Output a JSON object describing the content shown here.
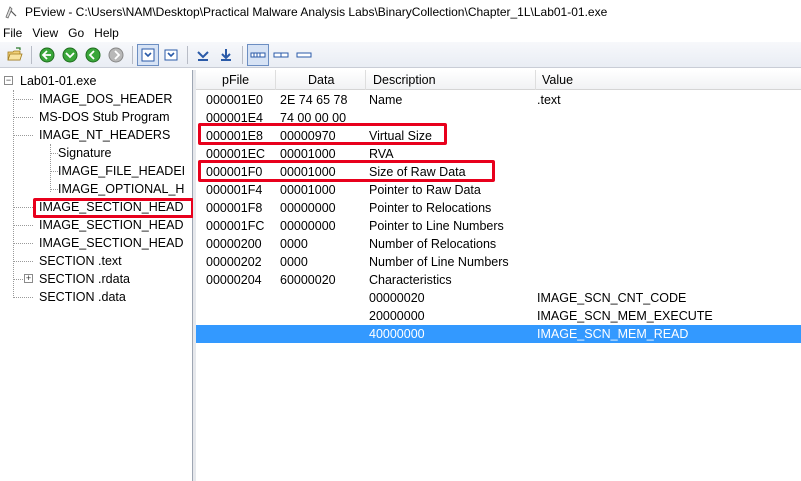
{
  "window": {
    "title": "PEview - C:\\Users\\NAM\\Desktop\\Practical Malware Analysis Labs\\BinaryCollection\\Chapter_1L\\Lab01-01.exe"
  },
  "menu": [
    "File",
    "View",
    "Go",
    "Help"
  ],
  "toolbar": {
    "icons": [
      "open-file-icon",
      "back-icon",
      "forward-icon",
      "up-icon",
      "stop-icon",
      "view-hex-icon",
      "view-value-icon",
      "nav-prev-icon",
      "nav-next-icon",
      "view-bytes-icon",
      "view-words-icon",
      "view-dwords-icon"
    ]
  },
  "tree": {
    "root": "Lab01-01.exe",
    "items": [
      "IMAGE_DOS_HEADER",
      "MS-DOS Stub Program",
      "IMAGE_NT_HEADERS",
      "Signature",
      "IMAGE_FILE_HEADEI",
      "IMAGE_OPTIONAL_H",
      "IMAGE_SECTION_HEAD",
      "IMAGE_SECTION_HEAD",
      "IMAGE_SECTION_HEAD",
      "SECTION .text",
      "SECTION .rdata",
      "SECTION .data"
    ]
  },
  "columns": [
    "pFile",
    "Data",
    "Description",
    "Value"
  ],
  "rows": [
    {
      "pfile": "000001E0",
      "data": "2E 74 65 78",
      "description": "Name",
      "value": ".text"
    },
    {
      "pfile": "000001E4",
      "data": "74 00 00 00",
      "description": "",
      "value": ""
    },
    {
      "pfile": "000001E8",
      "data": "00000970",
      "description": "Virtual Size",
      "value": ""
    },
    {
      "pfile": "000001EC",
      "data": "00001000",
      "description": "RVA",
      "value": ""
    },
    {
      "pfile": "000001F0",
      "data": "00001000",
      "description": "Size of Raw Data",
      "value": ""
    },
    {
      "pfile": "000001F4",
      "data": "00001000",
      "description": "Pointer to Raw Data",
      "value": ""
    },
    {
      "pfile": "000001F8",
      "data": "00000000",
      "description": "Pointer to Relocations",
      "value": ""
    },
    {
      "pfile": "000001FC",
      "data": "00000000",
      "description": "Pointer to Line Numbers",
      "value": ""
    },
    {
      "pfile": "00000200",
      "data": "0000",
      "description": "Number of Relocations",
      "value": ""
    },
    {
      "pfile": "00000202",
      "data": "0000",
      "description": "Number of Line Numbers",
      "value": ""
    },
    {
      "pfile": "00000204",
      "data": "60000020",
      "description": "Characteristics",
      "value": ""
    },
    {
      "pfile": "",
      "data": "",
      "description": "00000020",
      "value": "IMAGE_SCN_CNT_CODE"
    },
    {
      "pfile": "",
      "data": "",
      "description": "20000000",
      "value": "IMAGE_SCN_MEM_EXECUTE"
    },
    {
      "pfile": "",
      "data": "",
      "description": "40000000",
      "value": "IMAGE_SCN_MEM_READ"
    }
  ],
  "colors": {
    "selection": "#3399ff",
    "annotation": "#e8001c"
  }
}
